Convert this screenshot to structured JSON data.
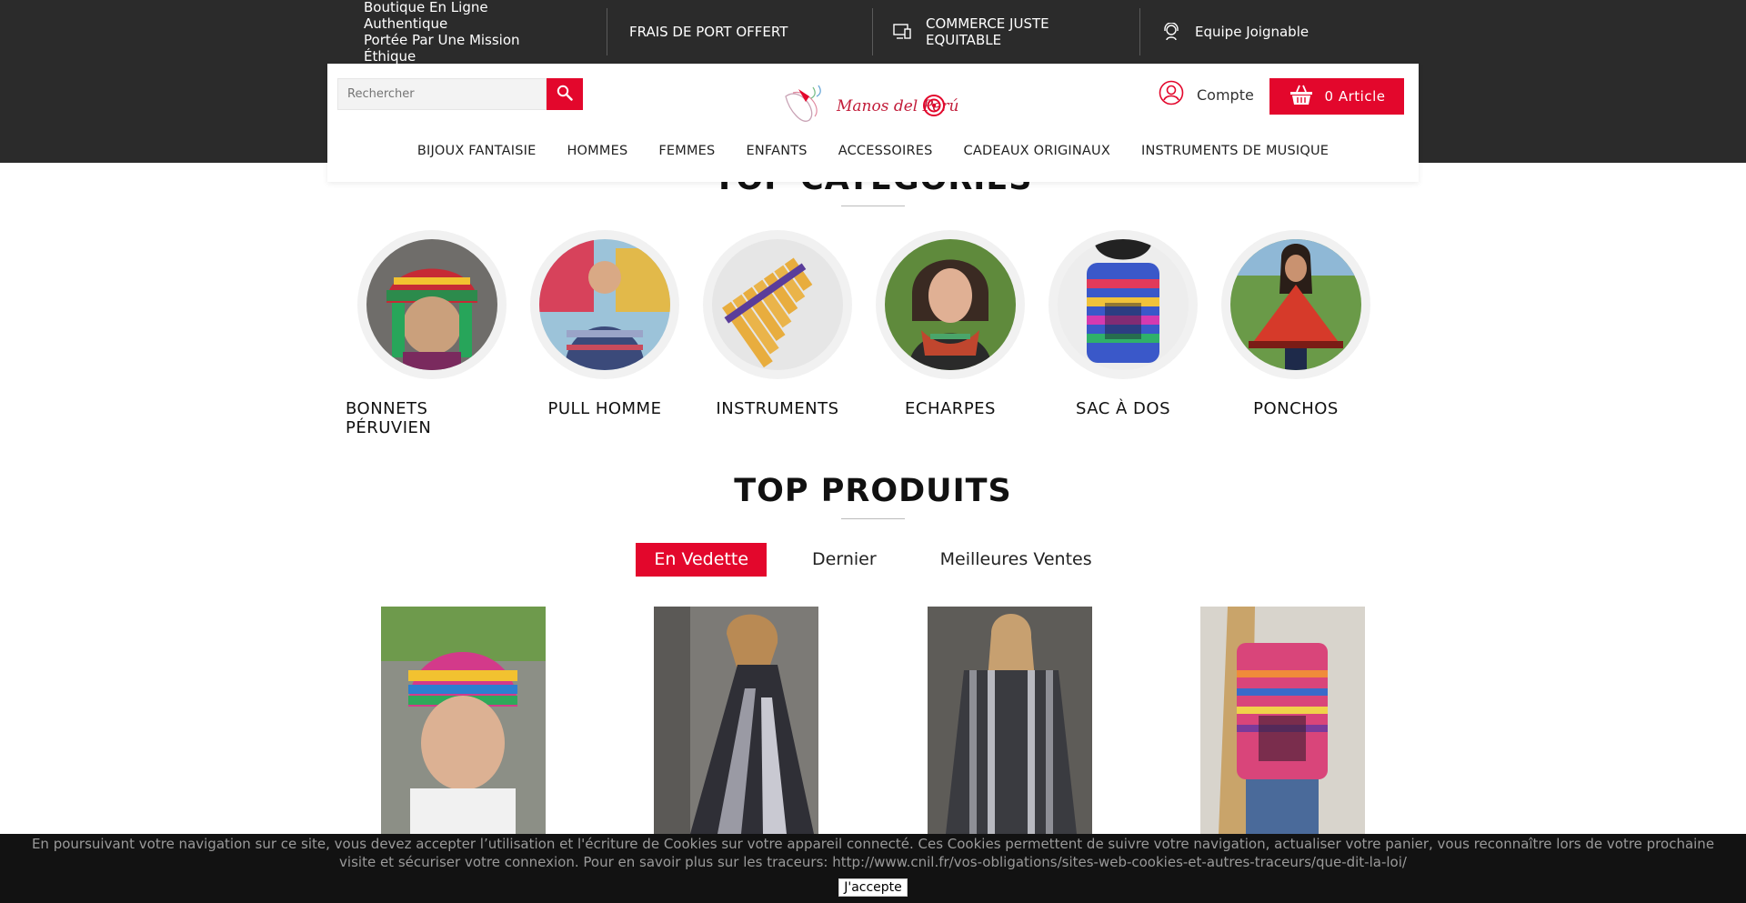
{
  "topbar": {
    "items": [
      {
        "line1": "Boutique En Ligne Authentique",
        "line2": "Portée Par Une Mission Éthique",
        "icon": "none"
      },
      {
        "line1": "FRAIS DE PORT OFFERT",
        "icon": "none"
      },
      {
        "line1": "COMMERCE JUSTE EQUITABLE",
        "icon": "monitor-icon"
      },
      {
        "line1": "Equipe Joignable",
        "icon": "support-agent-icon"
      }
    ]
  },
  "header": {
    "search_placeholder": "Rechercher",
    "logo_text": "Manos del Perú",
    "account_label": "Compte",
    "cart_label": "0 Article"
  },
  "nav": {
    "items": [
      "BIJOUX FANTAISIE",
      "HOMMES",
      "FEMMES",
      "ENFANTS",
      "ACCESSOIRES",
      "CADEAUX ORIGINAUX",
      "INSTRUMENTS DE MUSIQUE"
    ]
  },
  "top_categories": {
    "title": "TOP CATEGORIES",
    "items": [
      {
        "name": "BONNETS PÉRUVIEN"
      },
      {
        "name": "PULL HOMME"
      },
      {
        "name": "INSTRUMENTS"
      },
      {
        "name": "ECHARPES"
      },
      {
        "name": "SAC À DOS"
      },
      {
        "name": "PONCHOS"
      }
    ]
  },
  "top_products": {
    "title": "TOP PRODUITS",
    "tabs": [
      "En Vedette",
      "Dernier",
      "Meilleures Ventes"
    ],
    "active_tab": "En Vedette"
  },
  "cookie": {
    "text": "En poursuivant votre navigation sur ce site, vous devez accepter l’utilisation et l'écriture de Cookies sur votre appareil connecté. Ces Cookies permettent de suivre votre navigation, actualiser votre panier, vous reconnaître lors de votre prochaine visite et sécuriser votre connexion. Pour en savoir plus sur les traceurs: http://www.cnil.fr/vos-obligations/sites-web-cookies-et-autres-traceurs/que-dit-la-loi/",
    "button": "J'accepte"
  },
  "colors": {
    "accent": "#e3072c",
    "dark_band": "#2b2b2b",
    "cookie_bg": "#000000"
  }
}
